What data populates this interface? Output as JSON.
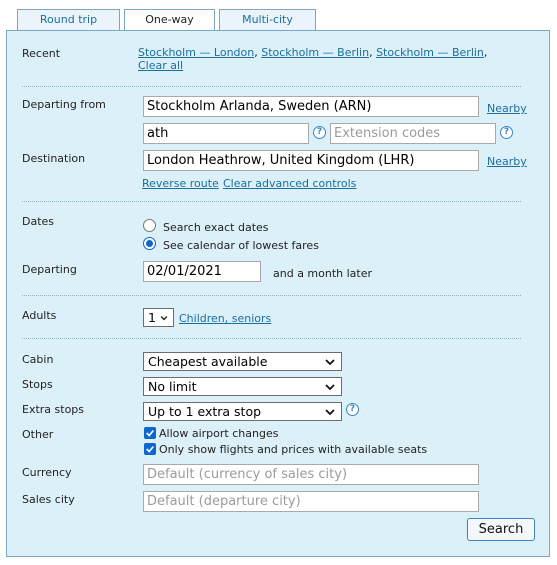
{
  "tabs": [
    "Round trip",
    "One-way",
    "Multi-city"
  ],
  "recent": {
    "label": "Recent",
    "items": [
      "Stockholm — London",
      "Stockholm — Berlin",
      "Stockholm — Berlin"
    ],
    "clear": "Clear all"
  },
  "departing_from": {
    "label": "Departing from",
    "value": "Stockholm Arlanda, Sweden (ARN)",
    "nearby": "Nearby",
    "routing": "ath",
    "extension_placeholder": "Extension codes"
  },
  "destination": {
    "label": "Destination",
    "value": "London Heathrow, United Kingdom (LHR)",
    "nearby": "Nearby",
    "reverse": "Reverse route",
    "clear_advanced": "Clear advanced controls"
  },
  "dates": {
    "label": "Dates",
    "exact": "Search exact dates",
    "calendar": "See calendar of lowest fares",
    "selected": "calendar"
  },
  "departing": {
    "label": "Departing",
    "value": "02/01/2021",
    "suffix": "and a month later"
  },
  "adults": {
    "label": "Adults",
    "value": "1",
    "children_link": "Children, seniors"
  },
  "cabin": {
    "label": "Cabin",
    "value": "Cheapest available"
  },
  "stops": {
    "label": "Stops",
    "value": "No limit"
  },
  "extra_stops": {
    "label": "Extra stops",
    "value": "Up to 1 extra stop"
  },
  "other": {
    "label": "Other",
    "allow_airport_changes": "Allow airport changes",
    "available_seats": "Only show flights and prices with available seats"
  },
  "currency": {
    "label": "Currency",
    "placeholder": "Default (currency of sales city)"
  },
  "sales_city": {
    "label": "Sales city",
    "placeholder": "Default (departure city)"
  },
  "search_button": "Search",
  "help_glyph": "?",
  "colors": {
    "accent": "#0b66d1",
    "link": "#1a6f9c",
    "panel": "#dcf0fa",
    "border": "#7aa7c7"
  }
}
